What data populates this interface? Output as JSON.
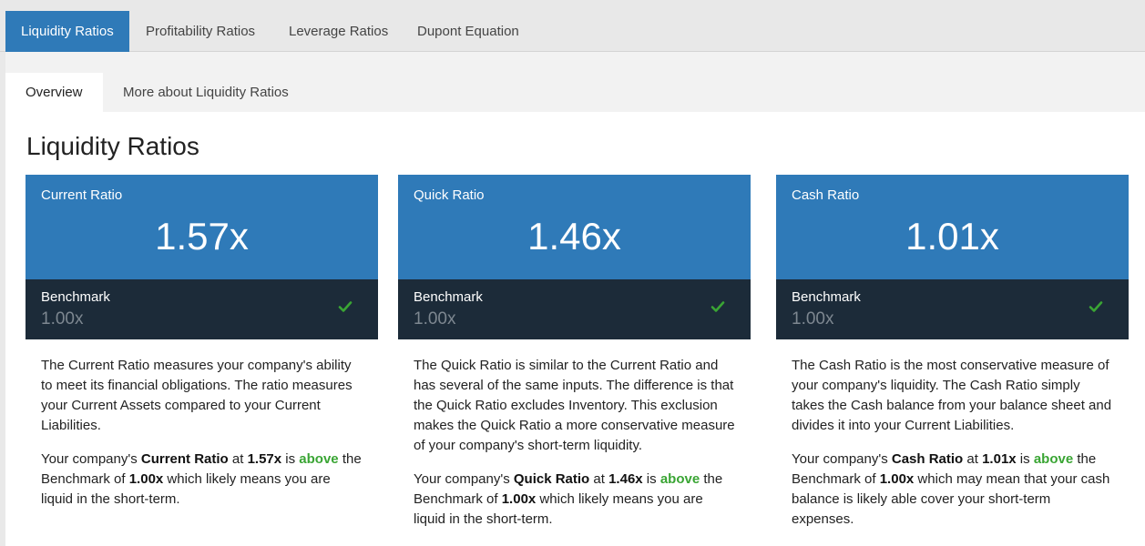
{
  "top_tabs": [
    {
      "label": "Liquidity Ratios",
      "active": true
    },
    {
      "label": "Profitability Ratios",
      "active": false
    },
    {
      "label": "Leverage Ratios",
      "active": false
    },
    {
      "label": "Dupont Equation",
      "active": false
    }
  ],
  "sub_tabs": [
    {
      "label": "Overview",
      "active": true
    },
    {
      "label": "More about Liquidity Ratios",
      "active": false
    }
  ],
  "page_title": "Liquidity Ratios",
  "cards": [
    {
      "name": "Current Ratio",
      "value": "1.57x",
      "benchmark_label": "Benchmark",
      "benchmark_value": "1.00x",
      "status_icon": "check-icon",
      "description": "The Current Ratio measures your company's ability to meet its financial obligations. The ratio measures your Current Assets compared to your Current Liabilities.",
      "summary": {
        "prefix": "Your company's ",
        "ratio_name": "Current Ratio",
        "at": " at ",
        "ratio_value": "1.57x",
        "is": " is ",
        "status": "above",
        "the_benchmark_of": " the Benchmark of ",
        "benchmark_value": "1.00x",
        "suffix": " which likely means you are liquid in the short-term."
      }
    },
    {
      "name": "Quick Ratio",
      "value": "1.46x",
      "benchmark_label": "Benchmark",
      "benchmark_value": "1.00x",
      "status_icon": "check-icon",
      "description": "The Quick Ratio is similar to the Current Ratio and has several of the same inputs. The difference is that the Quick Ratio excludes Inventory. This exclusion makes the Quick Ratio a more conservative measure of your company's short-term liquidity.",
      "summary": {
        "prefix": "Your company's ",
        "ratio_name": "Quick Ratio",
        "at": " at ",
        "ratio_value": "1.46x",
        "is": " is ",
        "status": "above",
        "the_benchmark_of": " the Benchmark of ",
        "benchmark_value": "1.00x",
        "suffix": " which likely means you are liquid in the short-term."
      }
    },
    {
      "name": "Cash Ratio",
      "value": "1.01x",
      "benchmark_label": "Benchmark",
      "benchmark_value": "1.00x",
      "status_icon": "check-icon",
      "description": "The Cash Ratio is the most conservative measure of your company's liquidity. The Cash Ratio simply takes the Cash balance from your balance sheet and divides it into your Current Liabilities.",
      "summary": {
        "prefix": "Your company's ",
        "ratio_name": "Cash Ratio",
        "at": " at ",
        "ratio_value": "1.01x",
        "is": " is ",
        "status": "above",
        "the_benchmark_of": " the Benchmark of ",
        "benchmark_value": "1.00x",
        "suffix": " which may mean that your cash balance is likely able cover your short-term expenses."
      }
    }
  ],
  "colors": {
    "accent": "#2f7ab8",
    "benchmark_bg": "#1c2b39",
    "good": "#3aa534"
  }
}
